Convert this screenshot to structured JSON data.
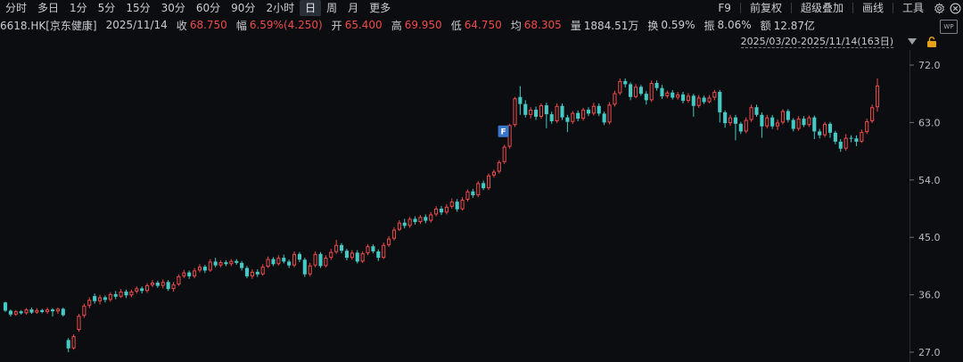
{
  "toolbar": {
    "tabs": [
      "分时",
      "多日",
      "1分",
      "5分",
      "15分",
      "30分",
      "60分",
      "90分",
      "2小时",
      "日",
      "周",
      "月",
      "更多"
    ],
    "active_tab": "日",
    "right_tools": [
      "F9",
      "前复权",
      "超级叠加",
      "画线",
      "工具"
    ]
  },
  "quote": {
    "symbol": "6618.HK[京东健康]",
    "date": "2025/11/14",
    "close_label": "收",
    "close": "68.750",
    "amp_label": "幅",
    "amp": "6.59%(4.250)",
    "open_label": "开",
    "open": "65.400",
    "high_label": "高",
    "high": "69.950",
    "low_label": "低",
    "low": "64.750",
    "avg_label": "均",
    "avg": "68.305",
    "vol_label": "量",
    "vol": "1884.51万",
    "turnover_label": "换",
    "turnover": "0.59%",
    "swing_label": "振",
    "swing": "8.06%",
    "amount_label": "额",
    "amount": "12.87亿"
  },
  "wp_badge": "WP",
  "range": "2025/03/20-2025/11/14(163日)",
  "marker_label": "F",
  "colors": {
    "up": "#ef4b4b",
    "down": "#44c9c4",
    "bg": "#0c0d10",
    "grid": "#1f2228"
  },
  "chart_data": {
    "type": "candlestick",
    "title": "",
    "xlabel": "",
    "ylabel": "",
    "y_ticks": [
      27.0,
      36.0,
      45.0,
      54.0,
      63.0,
      72.0
    ],
    "ylim": [
      26.0,
      73.0
    ],
    "marker": {
      "index": 96,
      "label": "F"
    },
    "candles": [
      [
        34.8,
        33.5,
        34.9,
        33.3
      ],
      [
        33.5,
        32.9,
        33.7,
        32.6
      ],
      [
        32.9,
        33.4,
        33.6,
        32.7
      ],
      [
        33.4,
        33.1,
        33.6,
        32.9
      ],
      [
        33.1,
        33.7,
        33.9,
        32.9
      ],
      [
        33.7,
        33.2,
        34.0,
        33.0
      ],
      [
        33.2,
        33.6,
        33.9,
        33.0
      ],
      [
        33.6,
        33.3,
        33.8,
        33.1
      ],
      [
        33.3,
        33.7,
        34.0,
        33.0
      ],
      [
        33.7,
        33.4,
        33.9,
        32.6
      ],
      [
        33.4,
        33.8,
        34.0,
        33.0
      ],
      [
        33.8,
        32.8,
        34.0,
        32.6
      ],
      [
        28.9,
        27.6,
        29.2,
        27.0
      ],
      [
        27.6,
        29.5,
        29.8,
        27.4
      ],
      [
        30.5,
        32.7,
        33.0,
        30.2
      ],
      [
        32.7,
        34.3,
        34.6,
        32.4
      ],
      [
        34.3,
        35.2,
        35.6,
        33.9
      ],
      [
        35.8,
        35.0,
        36.2,
        34.6
      ],
      [
        35.0,
        35.6,
        36.0,
        34.5
      ],
      [
        35.6,
        35.2,
        35.9,
        34.8
      ],
      [
        35.2,
        36.1,
        36.4,
        34.9
      ],
      [
        36.1,
        35.7,
        36.6,
        35.3
      ],
      [
        35.7,
        36.5,
        36.9,
        35.5
      ],
      [
        36.5,
        35.9,
        36.8,
        35.5
      ],
      [
        35.9,
        36.5,
        36.8,
        35.6
      ],
      [
        36.5,
        37.0,
        37.3,
        36.2
      ],
      [
        37.0,
        36.6,
        37.3,
        36.2
      ],
      [
        36.6,
        37.5,
        37.8,
        36.3
      ],
      [
        37.5,
        37.9,
        38.3,
        37.2
      ],
      [
        37.9,
        37.4,
        38.2,
        37.1
      ],
      [
        37.4,
        38.0,
        38.4,
        37.0
      ],
      [
        38.0,
        36.9,
        38.3,
        36.6
      ],
      [
        36.9,
        37.6,
        38.0,
        36.5
      ],
      [
        37.6,
        38.9,
        39.2,
        37.4
      ],
      [
        38.9,
        39.5,
        39.9,
        38.6
      ],
      [
        39.5,
        38.9,
        39.8,
        38.5
      ],
      [
        38.9,
        39.8,
        40.2,
        38.6
      ],
      [
        39.8,
        40.4,
        40.8,
        39.5
      ],
      [
        40.4,
        39.8,
        40.7,
        39.4
      ],
      [
        39.8,
        41.2,
        41.6,
        39.6
      ],
      [
        41.2,
        40.6,
        41.8,
        40.3
      ],
      [
        40.6,
        41.1,
        41.4,
        40.3
      ],
      [
        41.1,
        40.8,
        41.4,
        40.5
      ],
      [
        40.8,
        41.3,
        41.6,
        40.5
      ],
      [
        41.3,
        41.0,
        41.6,
        40.7
      ],
      [
        41.0,
        40.2,
        41.3,
        39.8
      ],
      [
        40.2,
        38.9,
        40.5,
        38.6
      ],
      [
        38.9,
        39.6,
        40.0,
        38.5
      ],
      [
        39.6,
        39.2,
        40.0,
        38.8
      ],
      [
        39.2,
        40.4,
        40.8,
        39.0
      ],
      [
        40.4,
        41.6,
        42.0,
        40.2
      ],
      [
        41.6,
        40.8,
        41.9,
        40.5
      ],
      [
        40.8,
        41.8,
        42.2,
        40.6
      ],
      [
        41.8,
        41.2,
        42.3,
        40.9
      ],
      [
        41.2,
        40.6,
        41.5,
        40.2
      ],
      [
        40.6,
        42.4,
        42.8,
        40.3
      ],
      [
        42.4,
        41.5,
        42.7,
        41.1
      ],
      [
        41.5,
        39.2,
        41.8,
        38.8
      ],
      [
        39.2,
        40.6,
        41.0,
        38.9
      ],
      [
        40.6,
        42.4,
        42.8,
        40.3
      ],
      [
        42.4,
        40.5,
        42.7,
        40.2
      ],
      [
        40.5,
        41.8,
        42.2,
        40.3
      ],
      [
        41.8,
        42.7,
        43.2,
        41.5
      ],
      [
        42.7,
        43.8,
        44.6,
        42.4
      ],
      [
        43.8,
        42.9,
        44.1,
        42.5
      ],
      [
        42.9,
        41.8,
        43.2,
        41.4
      ],
      [
        41.8,
        42.6,
        43.0,
        41.5
      ],
      [
        42.6,
        41.2,
        43.0,
        40.9
      ],
      [
        41.2,
        42.5,
        42.8,
        41.0
      ],
      [
        42.5,
        43.6,
        43.9,
        42.2
      ],
      [
        43.6,
        42.8,
        43.9,
        42.5
      ],
      [
        42.8,
        41.8,
        43.1,
        41.3
      ],
      [
        41.8,
        43.8,
        44.2,
        41.6
      ],
      [
        43.8,
        44.8,
        45.2,
        43.5
      ],
      [
        44.8,
        46.2,
        46.6,
        44.5
      ],
      [
        46.2,
        47.3,
        47.7,
        46.0
      ],
      [
        47.3,
        46.8,
        47.9,
        46.4
      ],
      [
        46.8,
        47.9,
        48.2,
        46.5
      ],
      [
        47.9,
        47.4,
        48.3,
        47.0
      ],
      [
        47.4,
        48.2,
        48.5,
        47.1
      ],
      [
        48.2,
        47.6,
        48.6,
        47.2
      ],
      [
        47.6,
        48.6,
        49.0,
        47.3
      ],
      [
        48.6,
        49.5,
        49.9,
        48.3
      ],
      [
        49.5,
        48.9,
        49.9,
        48.5
      ],
      [
        48.9,
        49.8,
        50.2,
        48.6
      ],
      [
        49.8,
        50.6,
        51.1,
        49.5
      ],
      [
        50.6,
        49.4,
        51.0,
        49.0
      ],
      [
        49.4,
        50.9,
        51.3,
        49.2
      ],
      [
        50.9,
        52.2,
        52.5,
        50.6
      ],
      [
        52.2,
        51.6,
        52.6,
        51.2
      ],
      [
        51.6,
        53.5,
        53.8,
        51.3
      ],
      [
        53.5,
        52.7,
        53.9,
        52.4
      ],
      [
        52.7,
        54.7,
        55.0,
        52.4
      ],
      [
        54.7,
        55.3,
        55.6,
        54.4
      ],
      [
        55.3,
        56.8,
        57.1,
        55.0
      ],
      [
        56.8,
        59.2,
        59.5,
        56.5
      ],
      [
        59.2,
        62.6,
        62.8,
        58.9
      ],
      [
        62.6,
        66.8,
        67.0,
        62.3
      ],
      [
        67.0,
        65.9,
        68.7,
        64.2
      ],
      [
        65.9,
        64.2,
        66.5,
        63.8
      ],
      [
        64.2,
        65.0,
        65.4,
        63.6
      ],
      [
        65.0,
        63.9,
        65.5,
        63.4
      ],
      [
        63.9,
        65.7,
        66.0,
        63.6
      ],
      [
        65.7,
        64.3,
        66.1,
        62.1
      ],
      [
        64.3,
        63.2,
        64.7,
        62.8
      ],
      [
        63.2,
        65.6,
        66.0,
        62.9
      ],
      [
        65.6,
        63.8,
        66.0,
        63.4
      ],
      [
        63.8,
        63.1,
        64.2,
        61.5
      ],
      [
        63.1,
        64.5,
        64.8,
        62.8
      ],
      [
        64.5,
        63.6,
        64.9,
        63.2
      ],
      [
        63.6,
        65.0,
        65.3,
        63.3
      ],
      [
        65.0,
        64.4,
        65.4,
        64.0
      ],
      [
        64.4,
        65.6,
        66.1,
        64.1
      ],
      [
        65.6,
        64.4,
        66.0,
        64.0
      ],
      [
        64.4,
        63.0,
        64.7,
        62.6
      ],
      [
        63.0,
        65.8,
        66.2,
        62.7
      ],
      [
        65.8,
        67.6,
        68.0,
        65.5
      ],
      [
        67.6,
        69.5,
        69.9,
        67.3
      ],
      [
        69.5,
        69.0,
        69.9,
        68.5
      ],
      [
        69.0,
        67.0,
        69.3,
        66.5
      ],
      [
        67.0,
        68.6,
        69.0,
        66.8
      ],
      [
        68.6,
        67.5,
        68.9,
        67.2
      ],
      [
        67.5,
        66.5,
        67.9,
        65.8
      ],
      [
        66.5,
        69.2,
        69.6,
        66.2
      ],
      [
        69.2,
        68.4,
        69.6,
        68.0
      ],
      [
        68.4,
        67.1,
        68.9,
        66.7
      ],
      [
        67.1,
        67.7,
        68.0,
        66.8
      ],
      [
        67.7,
        66.9,
        68.1,
        66.6
      ],
      [
        66.9,
        67.4,
        67.8,
        66.6
      ],
      [
        67.4,
        66.4,
        67.8,
        66.0
      ],
      [
        66.4,
        67.2,
        67.6,
        66.1
      ],
      [
        67.2,
        65.6,
        67.5,
        63.9
      ],
      [
        65.6,
        66.9,
        67.3,
        65.3
      ],
      [
        66.9,
        66.2,
        67.2,
        65.9
      ],
      [
        66.2,
        66.9,
        67.3,
        66.0
      ],
      [
        66.9,
        67.8,
        68.1,
        66.5
      ],
      [
        67.8,
        64.6,
        68.1,
        63.0
      ],
      [
        64.6,
        62.9,
        64.9,
        62.2
      ],
      [
        62.9,
        63.8,
        64.2,
        62.5
      ],
      [
        63.8,
        62.8,
        64.2,
        60.2
      ],
      [
        62.8,
        61.6,
        63.1,
        61.2
      ],
      [
        61.6,
        63.4,
        63.8,
        61.3
      ],
      [
        63.4,
        65.4,
        65.8,
        63.1
      ],
      [
        65.4,
        64.2,
        65.8,
        63.9
      ],
      [
        64.2,
        62.4,
        64.6,
        60.6
      ],
      [
        62.4,
        63.8,
        64.2,
        62.1
      ],
      [
        63.8,
        62.4,
        64.2,
        62.0
      ],
      [
        62.4,
        63.0,
        63.5,
        61.8
      ],
      [
        63.0,
        64.8,
        65.1,
        62.7
      ],
      [
        64.8,
        63.4,
        65.1,
        63.0
      ],
      [
        63.4,
        62.0,
        63.7,
        61.6
      ],
      [
        62.0,
        63.6,
        64.0,
        61.7
      ],
      [
        63.6,
        62.6,
        64.0,
        62.3
      ],
      [
        62.6,
        63.8,
        64.1,
        62.3
      ],
      [
        63.8,
        61.6,
        64.1,
        60.4
      ],
      [
        61.6,
        61.0,
        62.0,
        60.5
      ],
      [
        61.0,
        62.8,
        63.1,
        60.7
      ],
      [
        62.8,
        61.4,
        63.1,
        60.6
      ],
      [
        61.4,
        60.0,
        61.7,
        59.6
      ],
      [
        60.0,
        58.9,
        60.4,
        58.4
      ],
      [
        58.9,
        60.6,
        61.2,
        58.6
      ],
      [
        60.6,
        60.5,
        61.0,
        59.9
      ],
      [
        60.5,
        60.0,
        61.0,
        59.3
      ],
      [
        60.0,
        61.5,
        61.9,
        59.8
      ],
      [
        61.5,
        63.2,
        63.6,
        61.2
      ],
      [
        63.2,
        65.4,
        65.8,
        62.9
      ],
      [
        65.4,
        68.8,
        69.9,
        64.7
      ]
    ]
  }
}
